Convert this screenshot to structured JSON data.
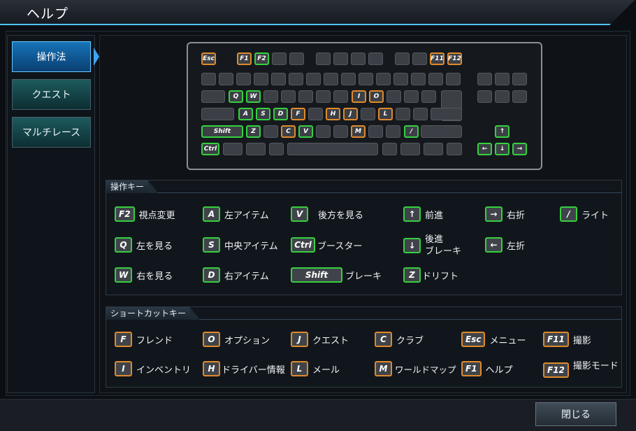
{
  "window": {
    "title": "ヘルプ",
    "close_label": "閉じる"
  },
  "nav": {
    "items": [
      {
        "label": "操作法",
        "active": true
      },
      {
        "label": "クエスト",
        "active": false
      },
      {
        "label": "マルチレース",
        "active": false
      }
    ]
  },
  "keyboard": {
    "keys": {
      "esc": "Esc",
      "f1": "F1",
      "f2": "F2",
      "f11": "F11",
      "f12": "F12",
      "q": "Q",
      "w": "W",
      "i": "I",
      "o": "O",
      "a": "A",
      "s": "S",
      "d": "D",
      "f": "F",
      "h": "H",
      "j": "J",
      "l": "L",
      "shift": "Shift",
      "z": "Z",
      "c": "C",
      "v": "V",
      "m": "M",
      "slash": "/",
      "ctrl": "Ctrl",
      "up": "↑",
      "left": "←",
      "down": "↓",
      "right": "→"
    }
  },
  "controls": {
    "title": "操作キー",
    "items": [
      {
        "key": "F2",
        "label": "視点変更"
      },
      {
        "key": "A",
        "label": "左アイテム"
      },
      {
        "key": "V",
        "label": "後方を見る"
      },
      {
        "key": "↑",
        "label": "前進"
      },
      {
        "key": "→",
        "label": "右折"
      },
      {
        "key": "/",
        "label": "ライト"
      },
      {
        "key": "Q",
        "label": "左を見る"
      },
      {
        "key": "S",
        "label": "中央アイテム"
      },
      {
        "key": "Ctrl",
        "label": "ブースター"
      },
      {
        "key": "↓",
        "label": "後進",
        "label2": "ブレーキ"
      },
      {
        "key": "←",
        "label": "左折"
      },
      {
        "key": "W",
        "label": "右を見る"
      },
      {
        "key": "D",
        "label": "右アイテム"
      },
      {
        "key": "Shift",
        "label": "ブレーキ"
      },
      {
        "key": "Z",
        "label": "ドリフト"
      }
    ]
  },
  "shortcuts": {
    "title": "ショートカットキー",
    "items": [
      {
        "key": "F",
        "label": "フレンド"
      },
      {
        "key": "O",
        "label": "オプション"
      },
      {
        "key": "J",
        "label": "クエスト"
      },
      {
        "key": "C",
        "label": "クラブ"
      },
      {
        "key": "Esc",
        "label": "メニュー"
      },
      {
        "key": "F11",
        "label": "撮影"
      },
      {
        "key": "I",
        "label": "インベントリ"
      },
      {
        "key": "H",
        "label": "ドライバー情報"
      },
      {
        "key": "L",
        "label": "メール"
      },
      {
        "key": "M",
        "label": "ワールドマップ"
      },
      {
        "key": "F1",
        "label": "ヘルプ"
      },
      {
        "key": "F12",
        "label": "撮影モード"
      }
    ]
  },
  "colors": {
    "control_key": "#35d040",
    "shortcut_key": "#e08a2a",
    "accent": "#4fc3ff"
  }
}
